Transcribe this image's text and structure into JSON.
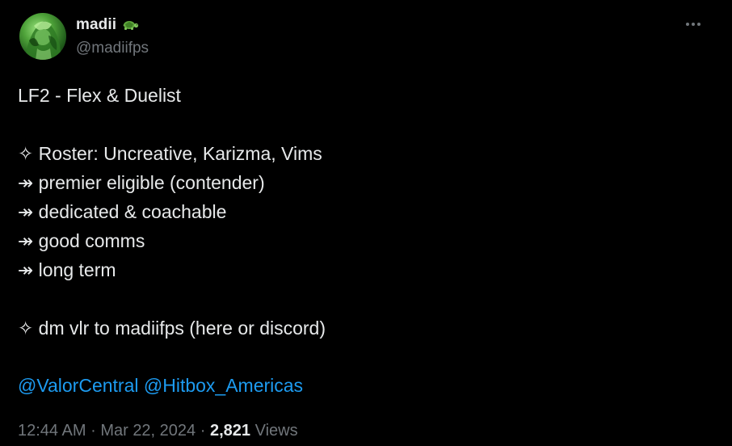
{
  "tweet": {
    "display_name": "madii",
    "name_emoji_icon": "turtle-icon",
    "handle": "@madiifps",
    "more_icon": "more-horizontal-icon",
    "lines": [
      "LF2 - Flex & Duelist",
      "",
      "✧ Roster: Uncreative, Karizma, Vims",
      "↠ premier eligible (contender)",
      "↠ dedicated & coachable",
      "↠ good comms",
      "↠ long term",
      "",
      "✧ dm vlr to madiifps (here or discord)"
    ],
    "mentions": [
      "@ValorCentral",
      "@Hitbox_Americas"
    ],
    "time": "12:44 AM",
    "separator": "·",
    "date": "Mar 22, 2024",
    "views_count": "2,821",
    "views_label": "Views"
  },
  "colors": {
    "background": "#000000",
    "text_primary": "#e7e9ea",
    "text_secondary": "#71767b",
    "link": "#1d9bf0"
  }
}
